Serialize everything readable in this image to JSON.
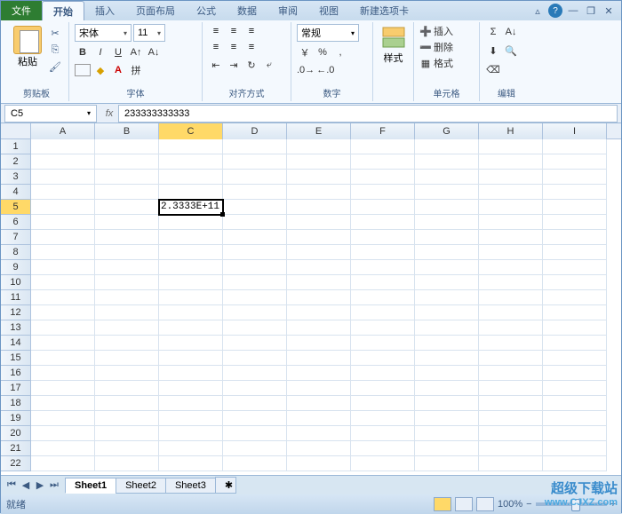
{
  "menu": {
    "file": "文件",
    "home": "开始",
    "insert": "插入",
    "layout": "页面布局",
    "formula": "公式",
    "data": "数据",
    "review": "审阅",
    "view": "视图",
    "newtab": "新建选项卡"
  },
  "ribbon": {
    "clipboard": {
      "paste": "粘贴",
      "label": "剪贴板"
    },
    "font": {
      "name": "宋体",
      "size": "11",
      "label": "字体"
    },
    "align": {
      "label": "对齐方式"
    },
    "number": {
      "format": "常规",
      "label": "数字"
    },
    "styles": {
      "btn": "样式",
      "label": ""
    },
    "cells": {
      "insert": "插入",
      "delete": "删除",
      "format": "格式",
      "label": "单元格"
    },
    "edit": {
      "label": "编辑"
    }
  },
  "formulaBar": {
    "name": "C5",
    "value": "233333333333"
  },
  "columns": [
    "A",
    "B",
    "C",
    "D",
    "E",
    "F",
    "G",
    "H",
    "I"
  ],
  "rows": [
    1,
    2,
    3,
    4,
    5,
    6,
    7,
    8,
    9,
    10,
    11,
    12,
    13,
    14,
    15,
    16,
    17,
    18,
    19,
    20,
    21,
    22
  ],
  "selected": {
    "col": "C",
    "row": 5,
    "display": "2.3333E+11"
  },
  "sheets": [
    "Sheet1",
    "Sheet2",
    "Sheet3"
  ],
  "status": {
    "ready": "就绪",
    "zoom": "100%"
  },
  "watermark": {
    "line1": "超级下载站",
    "line2": "www.CJXZ.com"
  }
}
